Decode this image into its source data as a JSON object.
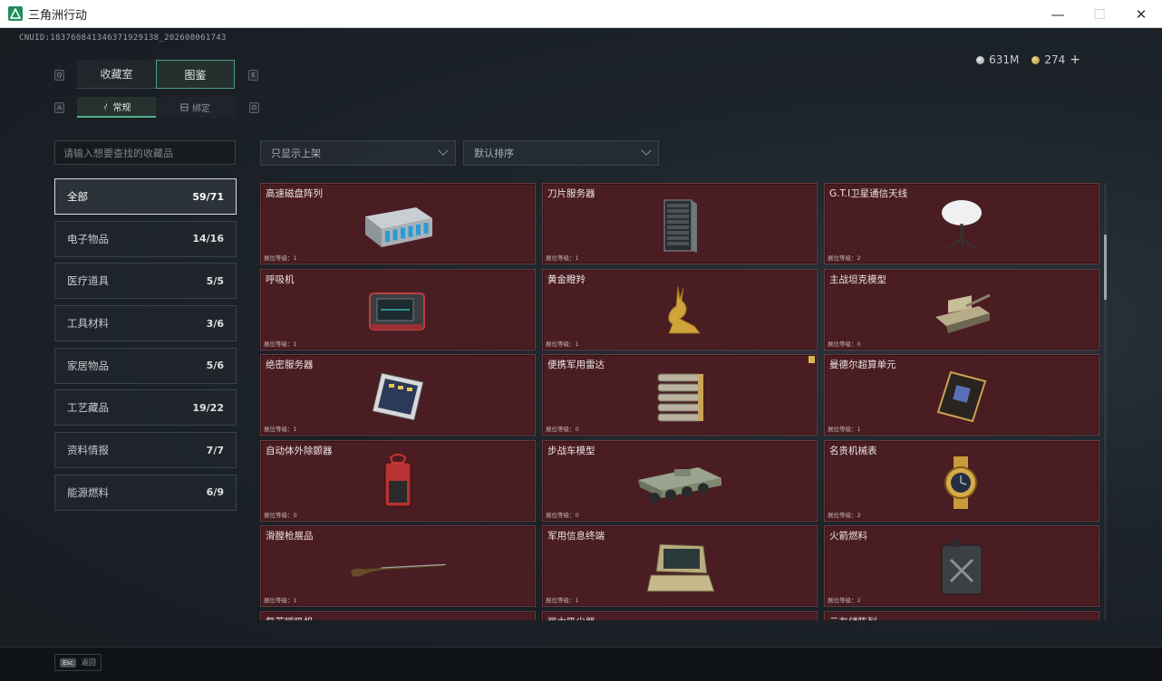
{
  "window": {
    "title": "三角洲行动",
    "minimize": "—",
    "maximize": "☐",
    "close": "✕"
  },
  "uid": "CNUID:183760841346371929138_202608061743",
  "currency": {
    "silver": "631M",
    "gold": "274",
    "add": "+"
  },
  "keyhints": {
    "q": "Q",
    "e": "E",
    "a": "A",
    "d": "D"
  },
  "main_tabs": [
    {
      "label": "收藏室"
    },
    {
      "label": "图鉴"
    }
  ],
  "sub_tabs": [
    {
      "label": "常规"
    },
    {
      "label": "绑定"
    }
  ],
  "search": {
    "placeholder": "请输入想要查找的收藏品"
  },
  "filters": {
    "shelf": "只显示上架",
    "sort": "默认排序"
  },
  "categories": [
    {
      "label": "全部",
      "count": "59/71"
    },
    {
      "label": "电子物品",
      "count": "14/16"
    },
    {
      "label": "医疗道具",
      "count": "5/5"
    },
    {
      "label": "工具材料",
      "count": "3/6"
    },
    {
      "label": "家居物品",
      "count": "5/6"
    },
    {
      "label": "工艺藏品",
      "count": "19/22"
    },
    {
      "label": "资料情报",
      "count": "7/7"
    },
    {
      "label": "能源燃料",
      "count": "6/9"
    }
  ],
  "items": [
    {
      "name": "高速磁盘阵列",
      "level": "展位等级：1",
      "icon": "disk-array-icon"
    },
    {
      "name": "刀片服务器",
      "level": "展位等级：1",
      "icon": "blade-server-icon"
    },
    {
      "name": "G.T.I卫星通信天线",
      "level": "展位等级：2",
      "icon": "satellite-dish-icon"
    },
    {
      "name": "呼吸机",
      "level": "展位等级：1",
      "icon": "ventilator-icon"
    },
    {
      "name": "黄金瞪羚",
      "level": "展位等级：1",
      "icon": "golden-gazelle-icon"
    },
    {
      "name": "主战坦克模型",
      "level": "展位等级：0",
      "icon": "tank-model-icon"
    },
    {
      "name": "绝密服务器",
      "level": "展位等级：1",
      "icon": "secret-server-icon"
    },
    {
      "name": "便携军用雷达",
      "level": "展位等级：0",
      "icon": "portable-radar-icon"
    },
    {
      "name": "曼德尔超算单元",
      "level": "展位等级：1",
      "icon": "supercomputer-unit-icon"
    },
    {
      "name": "自动体外除颤器",
      "level": "展位等级：0",
      "icon": "defibrillator-icon"
    },
    {
      "name": "步战车模型",
      "level": "展位等级：0",
      "icon": "ifv-model-icon"
    },
    {
      "name": "名贵机械表",
      "level": "展位等级：2",
      "icon": "mechanical-watch-icon"
    },
    {
      "name": "滑膛枪展品",
      "level": "展位等级：1",
      "icon": "musket-icon"
    },
    {
      "name": "军用信息终端",
      "level": "展位等级：1",
      "icon": "military-terminal-icon"
    },
    {
      "name": "火箭燃料",
      "level": "展位等级：2",
      "icon": "rocket-fuel-icon"
    },
    {
      "name": "复苏呼吸机",
      "level": "",
      "icon": "resuscitator-icon"
    },
    {
      "name": "强力吸尘器",
      "level": "",
      "icon": "vacuum-icon"
    },
    {
      "name": "云存储阵列",
      "level": "",
      "icon": "cloud-storage-icon"
    }
  ],
  "back": {
    "key": "Esc",
    "label": "返回"
  },
  "colors": {
    "card_bg": "#4a1d22",
    "accent": "#4fb18d",
    "gold_flag": "#d8b24a"
  }
}
